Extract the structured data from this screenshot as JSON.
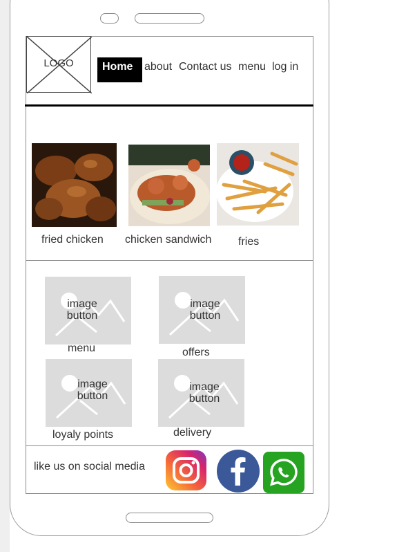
{
  "header": {
    "logo_text": "LOGO",
    "nav": {
      "home": "Home",
      "about": "about",
      "contact": "Contact us",
      "menu": "menu",
      "login": "log in"
    }
  },
  "featured": [
    {
      "caption": "fried chicken"
    },
    {
      "caption": "chicken sandwich"
    },
    {
      "caption": "fries"
    }
  ],
  "image_button_text": {
    "line1": "image",
    "line2": "button"
  },
  "buttons": [
    {
      "caption": "menu"
    },
    {
      "caption": "offers"
    },
    {
      "caption": "loyaly points"
    },
    {
      "caption": "delivery"
    }
  ],
  "footer": {
    "social_text": "like us on social media",
    "icons": [
      "instagram-icon",
      "facebook-icon",
      "whatsapp-icon"
    ]
  },
  "colors": {
    "nav_active_bg": "#000000",
    "placeholder_bg": "#dcdcdc",
    "facebook": "#3b5998",
    "whatsapp": "#25a321"
  }
}
